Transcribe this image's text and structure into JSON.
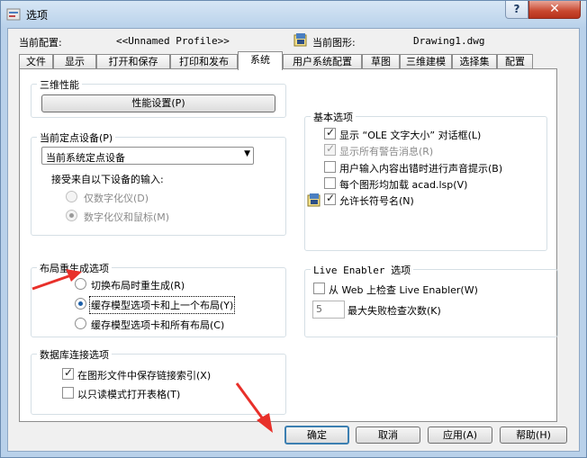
{
  "window": {
    "title": "选项",
    "help_glyph": "?",
    "close_glyph": "✕"
  },
  "header": {
    "profile_label": "当前配置:",
    "profile_value": "<<Unnamed Profile>>",
    "drawing_label": "当前图形:",
    "drawing_value": "Drawing1.dwg"
  },
  "tabs": [
    "文件",
    "显示",
    "打开和保存",
    "打印和发布",
    "系统",
    "用户系统配置",
    "草图",
    "三维建模",
    "选择集",
    "配置"
  ],
  "active_tab": "系统",
  "perf": {
    "title": "三维性能",
    "button": "性能设置(P)"
  },
  "pointing": {
    "title": "当前定点设备(P)",
    "selected": "当前系统定点设备",
    "accept_label": "接受来自以下设备的输入:",
    "opt1": "仅数字化仪(D)",
    "opt2": "数字化仪和鼠标(M)"
  },
  "layout_regen": {
    "title": "布局重生成选项",
    "opt1": "切换布局时重生成(R)",
    "opt2": "缓存模型选项卡和上一个布局(Y)",
    "opt3": "缓存模型选项卡和所有布局(C)"
  },
  "db": {
    "title": "数据库连接选项",
    "opt1": "在图形文件中保存链接索引(X)",
    "opt2": "以只读模式打开表格(T)"
  },
  "general": {
    "title": "基本选项",
    "opt1": "显示 “OLE 文字大小” 对话框(L)",
    "opt2": "显示所有警告消息(R)",
    "opt3": "用户输入内容出错时进行声音提示(B)",
    "opt4": "每个图形均加载 acad.lsp(V)",
    "opt5": "允许长符号名(N)"
  },
  "live": {
    "title": "Live Enabler 选项",
    "check_web": "从 Web 上检查 Live Enabler(W)",
    "max_value": "5",
    "max_label": "最大失败检查次数(K)"
  },
  "buttons": {
    "ok": "确定",
    "cancel": "取消",
    "apply": "应用(A)",
    "help": "帮助(H)"
  },
  "colors": {
    "annotation_arrow": "#e8302a",
    "title_bar": "#b9d1ea"
  }
}
